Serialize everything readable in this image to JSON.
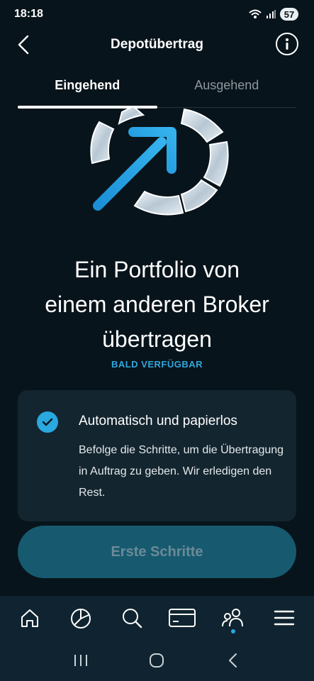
{
  "status_bar": {
    "time": "18:18",
    "battery": "57"
  },
  "header": {
    "title": "Depotübertrag"
  },
  "tabs": [
    {
      "label": "Eingehend",
      "active": true
    },
    {
      "label": "Ausgehend",
      "active": false
    }
  ],
  "hero": {
    "headline_line1": "Ein Portfolio von",
    "headline_line2": "einem anderen Broker",
    "headline_line3": "übertragen",
    "badge": "BALD VERFÜGBAR"
  },
  "feature_card": {
    "title": "Automatisch und papierlos",
    "text": "Befolge die Schritte, um die Übertragung in Auftrag zu geben. Wir erledigen den Rest."
  },
  "cta": {
    "label": "Erste Schritte"
  },
  "bottom_nav": [
    {
      "icon": "home-icon"
    },
    {
      "icon": "pie-chart-icon"
    },
    {
      "icon": "search-icon"
    },
    {
      "icon": "card-icon"
    },
    {
      "icon": "people-icon",
      "active": true
    },
    {
      "icon": "menu-icon"
    }
  ],
  "colors": {
    "background": "#08141b",
    "accent": "#2aa8e0",
    "card": "#13252f",
    "cta_disabled": "#175a70"
  }
}
